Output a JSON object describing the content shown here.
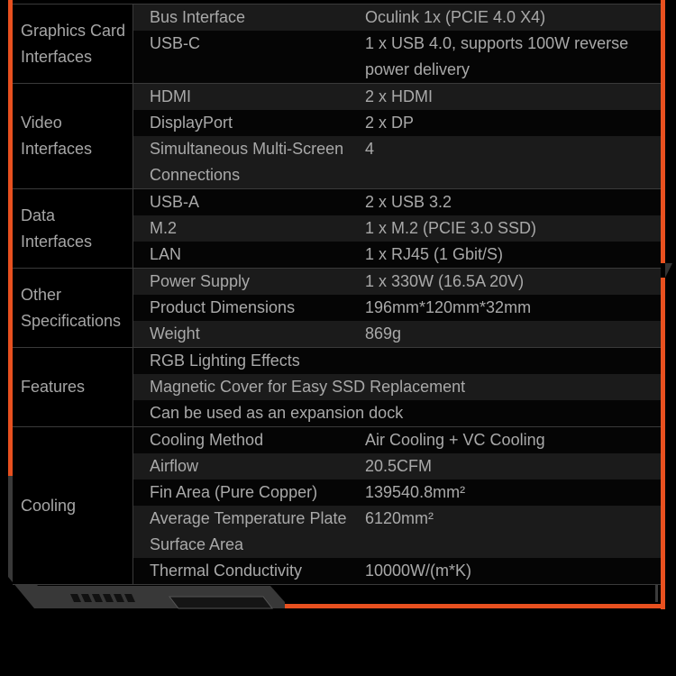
{
  "accent_color": "#e8501f",
  "groups": [
    {
      "category": [
        "Graphics Card",
        "Interfaces"
      ],
      "rows": [
        {
          "label": "Bus Interface",
          "value": "Oculink 1x (PCIE 4.0 X4)",
          "shade": "shade"
        },
        {
          "label": "USB-C",
          "value": "1 x USB 4.0, supports 100W reverse power delivery",
          "shade": "dark"
        }
      ]
    },
    {
      "category": [
        "Video",
        "Interfaces"
      ],
      "rows": [
        {
          "label": "HDMI",
          "value": "2 x HDMI",
          "shade": "shade"
        },
        {
          "label": "DisplayPort",
          "value": "2 x DP",
          "shade": "dark"
        },
        {
          "label": "Simultaneous Multi-Screen Connections",
          "value": "4",
          "shade": "shade"
        }
      ]
    },
    {
      "category": [
        "Data",
        "Interfaces"
      ],
      "rows": [
        {
          "label": "USB-A",
          "value": "2 x USB 3.2",
          "shade": "dark"
        },
        {
          "label": "M.2",
          "value": "1 x M.2 (PCIE 3.0 SSD)",
          "shade": "shade"
        },
        {
          "label": "LAN",
          "value": "1 x RJ45 (1 Gbit/S)",
          "shade": "dark"
        }
      ]
    },
    {
      "category": [
        "Other",
        "Specifications"
      ],
      "rows": [
        {
          "label": "Power Supply",
          "value": "1 x 330W (16.5A 20V)",
          "shade": "shade"
        },
        {
          "label": "Product Dimensions",
          "value": "196mm*120mm*32mm",
          "shade": "dark"
        },
        {
          "label": "Weight",
          "value": "869g",
          "shade": "shade"
        }
      ]
    },
    {
      "category": [
        "Features"
      ],
      "rows": [
        {
          "label": "RGB Lighting Effects",
          "value": null,
          "shade": "dark"
        },
        {
          "label": "Magnetic Cover for Easy SSD Replacement",
          "value": null,
          "shade": "shade"
        },
        {
          "label": "Can be used as an expansion dock",
          "value": null,
          "shade": "dark"
        }
      ]
    },
    {
      "category": [
        "Cooling"
      ],
      "rows": [
        {
          "label": "Cooling Method",
          "value": "Air Cooling + VC Cooling",
          "shade": "dark"
        },
        {
          "label": "Airflow",
          "value": "20.5CFM",
          "shade": "shade"
        },
        {
          "label": "Fin Area (Pure Copper)",
          "value": "139540.8mm²",
          "shade": "dark"
        },
        {
          "label": "Average Temperature Plate Surface Area",
          "value": "6120mm²",
          "shade": "shade"
        },
        {
          "label": "Thermal Conductivity",
          "value": "10000W/(m*K)",
          "shade": "dark"
        }
      ]
    }
  ]
}
